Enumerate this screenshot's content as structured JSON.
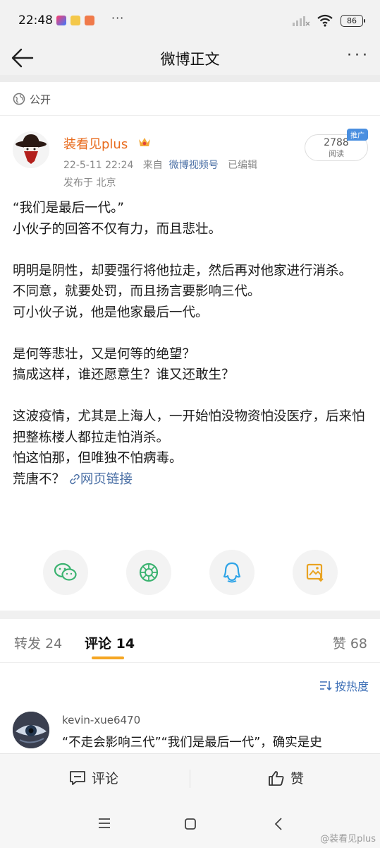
{
  "status": {
    "time": "22:48",
    "more": "···",
    "battery": "86"
  },
  "nav": {
    "title": "微博正文",
    "more": "···"
  },
  "visibility": {
    "label": "公开"
  },
  "author": {
    "name": "装看见plus",
    "date": "22-5-11 22:24",
    "source_prefix": "来自",
    "source": "微博视频号",
    "edited": "已编辑",
    "location": "发布于 北京"
  },
  "read_badge": {
    "count": "2788",
    "label": "阅读",
    "tag": "推广"
  },
  "post": {
    "lines": [
      "“我们是最后一代。”",
      "小伙子的回答不仅有力，而且悲壮。",
      "",
      "明明是阴性，却要强行将他拉走，然后再对他家进行消杀。",
      "不同意，就要处罚，而且扬言要影响三代。",
      "可小伙子说，他是他家最后一代。",
      "",
      "是何等悲壮，又是何等的绝望？",
      "搞成这样，谁还愿意生？谁又还敢生？",
      "",
      "这波疫情，尤其是上海人，一开始怕没物资怕没医疗，后来怕把整栋楼人都拉走怕消杀。",
      "怕这怕那，但唯独不怕病毒。"
    ],
    "last_line_text": "荒唐不？",
    "link_text": "网页链接"
  },
  "share": [
    {
      "name": "wechat"
    },
    {
      "name": "moments"
    },
    {
      "name": "qq"
    },
    {
      "name": "save-image"
    }
  ],
  "tabs": {
    "repost": "转发 24",
    "comment": "评论 14",
    "like": "赞 68"
  },
  "sort_label": "按热度",
  "comment": {
    "user": "kevin-xue6470",
    "text": "“不走会影响三代”“我们是最后一代”，确实是史"
  },
  "actions": {
    "comment": "评论",
    "like": "赞"
  },
  "watermark": "@装看见plus",
  "colors": {
    "author": "#e86b1d",
    "link": "#4a6fa5",
    "tab_underline": "#f5a623",
    "promo": "#4a8fe0"
  }
}
